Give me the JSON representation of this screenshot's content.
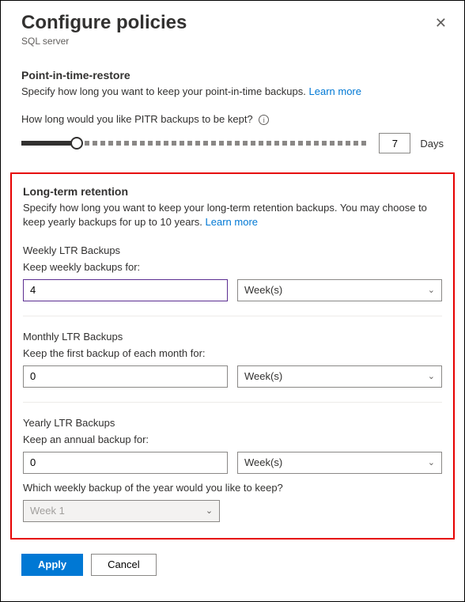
{
  "header": {
    "title": "Configure policies",
    "subtitle": "SQL server"
  },
  "pitr": {
    "title": "Point-in-time-restore",
    "desc": "Specify how long you want to keep your point-in-time backups.",
    "learn": "Learn more",
    "question": "How long would you like PITR backups to be kept?",
    "value": "7",
    "unit": "Days"
  },
  "ltr": {
    "title": "Long-term retention",
    "desc": "Specify how long you want to keep your long-term retention backups. You may choose to keep yearly backups for up to 10 years.",
    "learn": "Learn more",
    "weekly": {
      "heading": "Weekly LTR Backups",
      "label": "Keep weekly backups for:",
      "value": "4",
      "unit": "Week(s)"
    },
    "monthly": {
      "heading": "Monthly LTR Backups",
      "label": "Keep the first backup of each month for:",
      "value": "0",
      "unit": "Week(s)"
    },
    "yearly": {
      "heading": "Yearly LTR Backups",
      "label": "Keep an annual backup for:",
      "value": "0",
      "unit": "Week(s)",
      "which_label": "Which weekly backup of the year would you like to keep?",
      "which_value": "Week 1"
    }
  },
  "footer": {
    "apply": "Apply",
    "cancel": "Cancel"
  }
}
